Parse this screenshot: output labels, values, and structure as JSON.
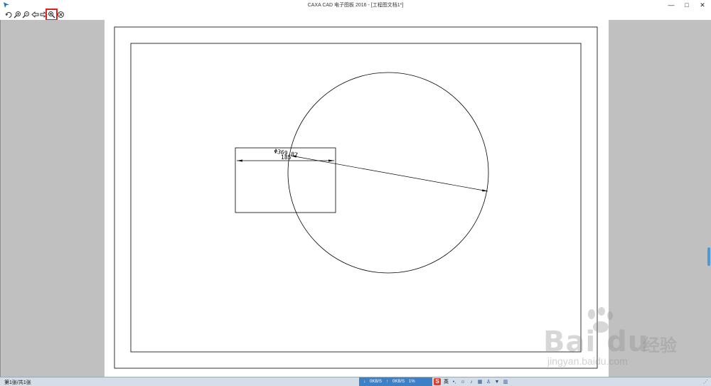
{
  "window": {
    "title": "CAXA CAD 电子图板 2016 - [工程图文档1*]",
    "minimize_glyph": "—",
    "maximize_glyph": "□",
    "close_glyph": "✕"
  },
  "toolbar": {
    "items": [
      {
        "name": "pan-icon"
      },
      {
        "name": "zoom-in-icon"
      },
      {
        "name": "zoom-out-icon"
      },
      {
        "name": "previous-view-icon"
      },
      {
        "name": "next-view-icon"
      },
      {
        "name": "print-preview-zoom-icon",
        "active": true
      },
      {
        "name": "close-preview-icon"
      }
    ],
    "highlight_color": "#e0201c"
  },
  "drawing": {
    "dim_diameter_text": "Φ369.87",
    "dim_linear_text": "185",
    "line_color": "#000000"
  },
  "statusbar": {
    "sheet_text": "第1张/共1张",
    "net_down": "0KB/S",
    "net_up": "0KB/S",
    "cpu": "1%",
    "ime_lang": "英",
    "ime_logo": "S"
  },
  "watermark": {
    "logo": "Bai du",
    "cn": "经验",
    "url": "jingyan.baidu.com"
  }
}
